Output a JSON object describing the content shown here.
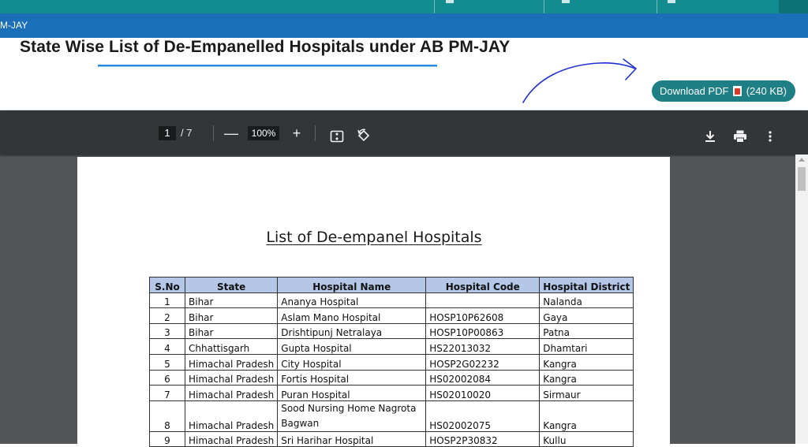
{
  "banner": {
    "text": "M-JAY"
  },
  "heading": {
    "title": "State Wise List of De-Empanelled Hospitals under AB PM-JAY"
  },
  "download": {
    "label": "Download PDF",
    "size": "(240 KB)"
  },
  "viewer": {
    "current_page": "1",
    "page_total": "/ 7",
    "zoom": "100%",
    "zoom_out_symbol": "—",
    "zoom_in_symbol": "+"
  },
  "document": {
    "title": "List of De-empanel Hospitals",
    "columns": [
      "S.No",
      "State",
      "Hospital Name",
      "Hospital Code",
      "Hospital District"
    ],
    "rows": [
      [
        "1",
        "Bihar",
        "Ananya Hospital",
        "",
        "Nalanda"
      ],
      [
        "2",
        "Bihar",
        "Aslam Mano Hospital",
        "HOSP10P62608",
        "Gaya"
      ],
      [
        "3",
        "Bihar",
        "Drishtipunj Netralaya",
        "HOSP10P00863",
        "Patna"
      ],
      [
        "4",
        "Chhattisgarh",
        "Gupta Hospital",
        "HS22013032",
        "Dhamtari"
      ],
      [
        "5",
        "Himachal Pradesh",
        "City Hospital",
        "HOSP2G02232",
        "Kangra"
      ],
      [
        "6",
        "Himachal Pradesh",
        "Fortis Hospital",
        "HS02002084",
        "Kangra"
      ],
      [
        "7",
        "Himachal Pradesh",
        "Puran Hospital",
        "HS02010020",
        "Sirmaur"
      ],
      [
        "8",
        "Himachal Pradesh",
        "Sood Nursing Home Nagrota Bagwan",
        "HS02002075",
        "Kangra"
      ],
      [
        "9",
        "Himachal Pradesh",
        "Sri Harihar Hospital",
        "HOSP2P30832",
        "Kullu"
      ]
    ]
  },
  "colors": {
    "top_bar": "#128c8f",
    "nav_bar": "#1a6fb8",
    "download_button": "#1e7f84",
    "viewer_toolbar": "#323639",
    "viewer_background": "#525659",
    "table_header": "#b4c7e7",
    "underline": "#2a8ae0"
  },
  "icons": [
    "pdf-file-icon",
    "fit-page-icon",
    "rotate-icon",
    "download-icon",
    "print-icon",
    "more-options-icon",
    "hand-drawn-arrow-icon"
  ]
}
